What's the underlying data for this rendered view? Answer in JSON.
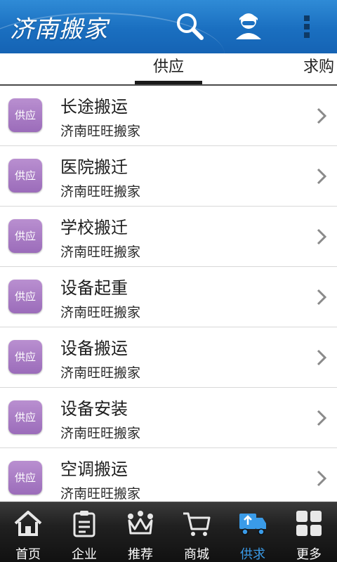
{
  "header": {
    "title": "济南搬家",
    "search_icon": "search-icon",
    "user_icon": "user-icon",
    "menu_icon": "more-vert-icon"
  },
  "tabs": [
    {
      "label": "供应",
      "selected": true
    },
    {
      "label": "求购",
      "selected": false
    }
  ],
  "list": {
    "items": [
      {
        "badge": "供应",
        "title": "长途搬运",
        "subtitle": "济南旺旺搬家"
      },
      {
        "badge": "供应",
        "title": "医院搬迁",
        "subtitle": "济南旺旺搬家"
      },
      {
        "badge": "供应",
        "title": "学校搬迁",
        "subtitle": "济南旺旺搬家"
      },
      {
        "badge": "供应",
        "title": "设备起重",
        "subtitle": "济南旺旺搬家"
      },
      {
        "badge": "供应",
        "title": "设备搬运",
        "subtitle": "济南旺旺搬家"
      },
      {
        "badge": "供应",
        "title": "设备安装",
        "subtitle": "济南旺旺搬家"
      },
      {
        "badge": "供应",
        "title": "空调搬运",
        "subtitle": "济南旺旺搬家"
      }
    ]
  },
  "bottom_nav": {
    "items": [
      {
        "label": "首页",
        "icon": "home-icon",
        "active": false
      },
      {
        "label": "企业",
        "icon": "clipboard-icon",
        "active": false
      },
      {
        "label": "推荐",
        "icon": "crown-icon",
        "active": false
      },
      {
        "label": "商城",
        "icon": "cart-icon",
        "active": false
      },
      {
        "label": "供求",
        "icon": "truck-icon",
        "active": true
      },
      {
        "label": "更多",
        "icon": "grid-icon",
        "active": false
      }
    ]
  },
  "colors": {
    "header_blue": "#1a6fc0",
    "badge_purple": "#9b6cba",
    "nav_active": "#3a9be8"
  }
}
